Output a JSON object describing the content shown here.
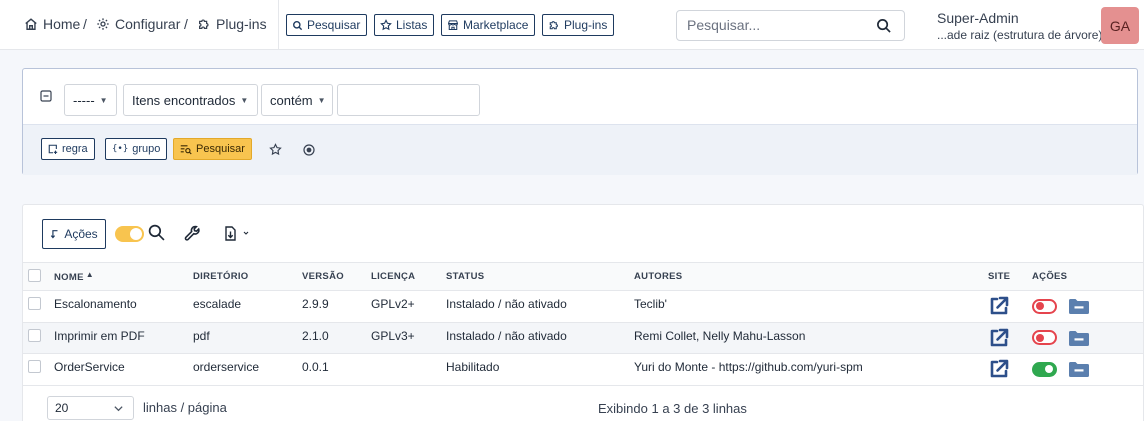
{
  "breadcrumb": {
    "home": "Home",
    "setup": "Configurar",
    "plugins": "Plug-ins",
    "separator": "/"
  },
  "quick_links": [
    {
      "label": "Pesquisar",
      "icon": "search-icon"
    },
    {
      "label": "Listas",
      "icon": "star-icon"
    },
    {
      "label": "Marketplace",
      "icon": "store-icon"
    },
    {
      "label": "Plug-ins",
      "icon": "puzzle-icon"
    }
  ],
  "global_search": {
    "placeholder": "Pesquisar..."
  },
  "user": {
    "profile": "Super-Admin",
    "entity": "...ade raiz (estrutura de árvore)",
    "initials": "GA",
    "avatar_color": "#e49090"
  },
  "criteria": {
    "field_select": "-----",
    "link_select": "Itens encontrados",
    "operator_select": "contém",
    "value": "",
    "rule_button": "regra",
    "group_button": "grupo",
    "search_button": "Pesquisar"
  },
  "toolbar": {
    "actions_button": "Ações"
  },
  "table": {
    "columns": [
      "NOME",
      "DIRETÓRIO",
      "VERSÃO",
      "LICENÇA",
      "STATUS",
      "AUTORES",
      "SITE",
      "AÇÕES"
    ],
    "rows": [
      {
        "name": "Escalonamento",
        "directory": "escalade",
        "version": "2.9.9",
        "license": "GPLv2+",
        "status": "Instalado / não ativado",
        "authors": "Teclib'",
        "enabled": false
      },
      {
        "name": "Imprimir em PDF",
        "directory": "pdf",
        "version": "2.1.0",
        "license": "GPLv3+",
        "status": "Instalado / não ativado",
        "authors": "Remi Collet, Nelly Mahu-Lasson",
        "enabled": false
      },
      {
        "name": "OrderService",
        "directory": "orderservice",
        "version": "0.0.1",
        "license": "",
        "status": "Habilitado",
        "authors": "Yuri do Monte - https://github.com/yuri-spm",
        "enabled": true
      }
    ]
  },
  "pagination": {
    "per_page": "20",
    "per_page_label": "linhas / página",
    "showing": "Exibindo 1 a 3 de 3 linhas"
  },
  "colors": {
    "accent": "#f8c44f",
    "link": "#2d4f8a",
    "toggle_off": "#e5444d",
    "toggle_on": "#2fa84f"
  }
}
